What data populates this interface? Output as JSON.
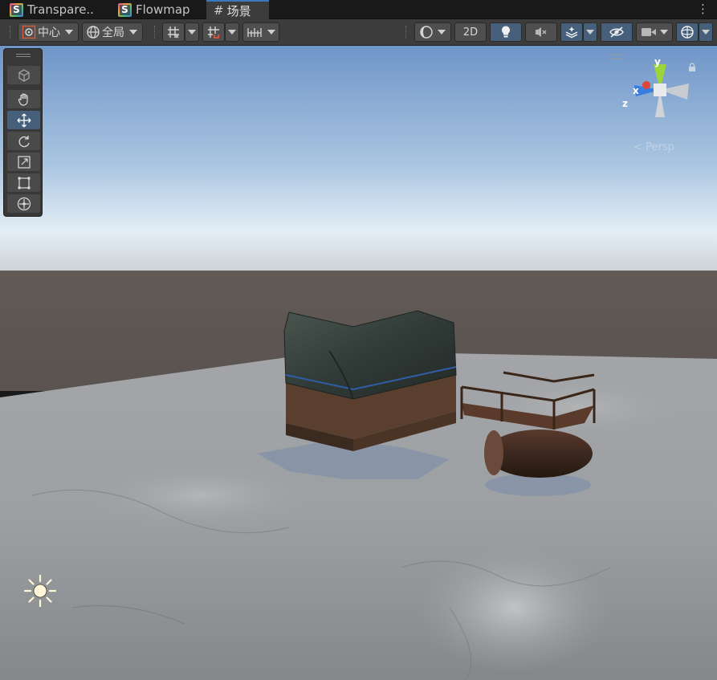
{
  "tabs": [
    {
      "label": "Transpare..",
      "icon": "shader-icon"
    },
    {
      "label": "Flowmap",
      "icon": "shader-icon"
    },
    {
      "label": "场景",
      "icon": "scene-hash-icon",
      "active": true
    }
  ],
  "toolbar": {
    "pivot_label": "中心",
    "space_label": "全局",
    "toggle_2d_label": "2D"
  },
  "tools": [
    "view-cube-icon",
    "hand-icon",
    "move-icon",
    "rotate-icon",
    "scale-icon",
    "rect-icon",
    "transform-icon"
  ],
  "gizmo": {
    "x_label": "x",
    "y_label": "y",
    "z_label": "z",
    "projection_label": "< Persp"
  },
  "colors": {
    "accent": "#3a79bb",
    "selected": "#46607c",
    "axis_x": "#e0453a",
    "axis_y": "#9bd43a",
    "axis_z": "#3a7de0"
  }
}
